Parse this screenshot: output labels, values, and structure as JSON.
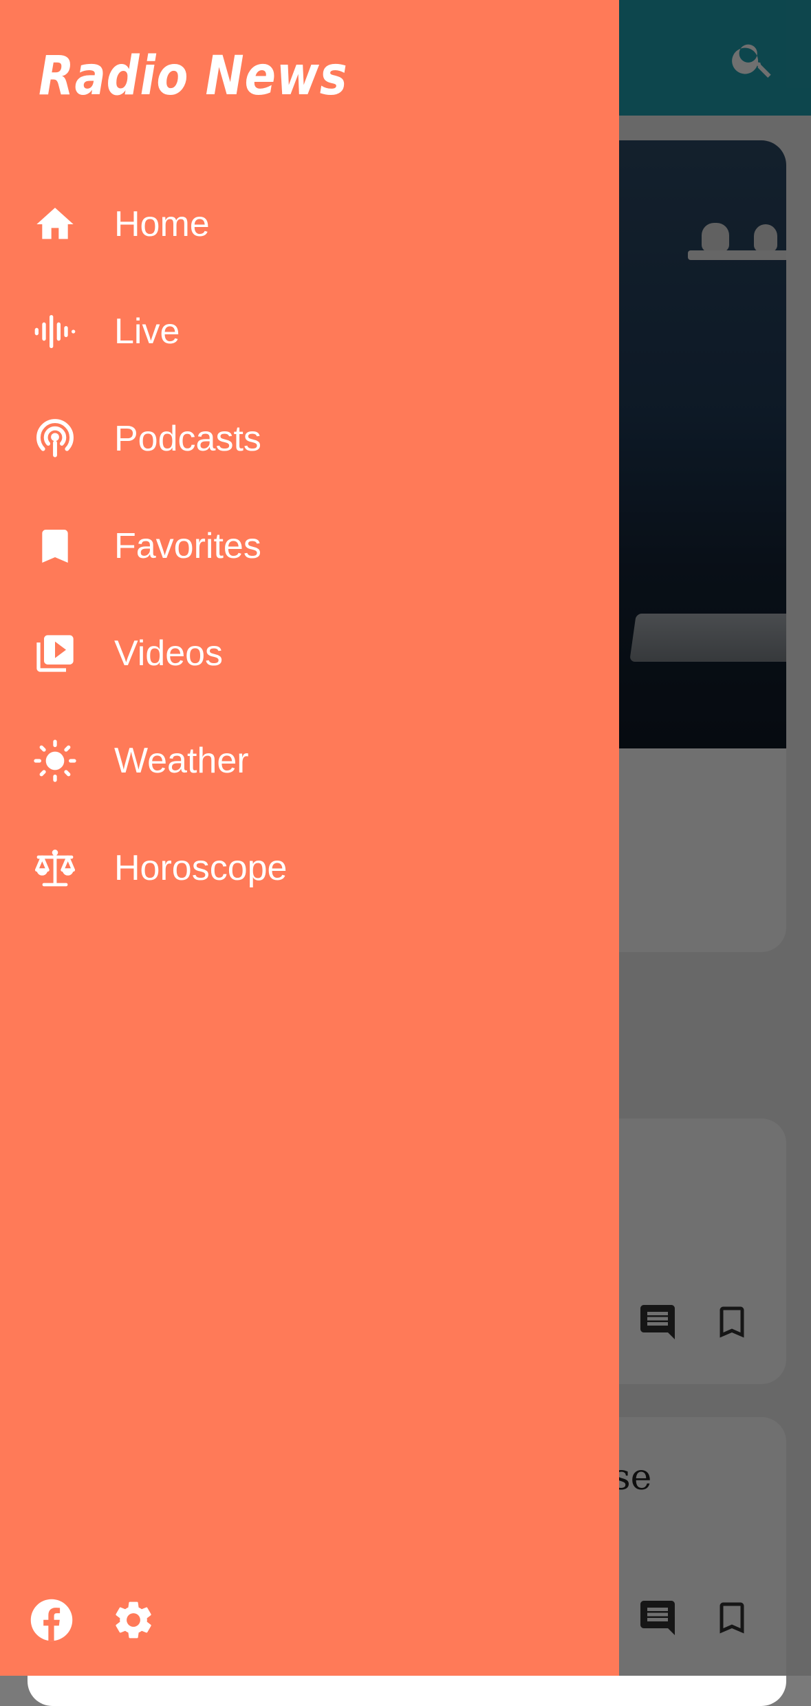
{
  "drawer": {
    "title": "Radio News",
    "items": [
      {
        "label": "Home",
        "icon": "home-icon"
      },
      {
        "label": "Live",
        "icon": "live-audio-icon"
      },
      {
        "label": "Podcasts",
        "icon": "podcast-icon"
      },
      {
        "label": "Favorites",
        "icon": "bookmark-icon"
      },
      {
        "label": "Videos",
        "icon": "video-library-icon"
      },
      {
        "label": "Weather",
        "icon": "sun-icon"
      },
      {
        "label": "Horoscope",
        "icon": "balance-scale-icon"
      }
    ],
    "footer_icons": [
      "facebook-icon",
      "gear-icon"
    ]
  },
  "background": {
    "card3_text_fragment": "se"
  },
  "colors": {
    "drawer_bg": "#ff7a58",
    "appbar": "#1f9fb0",
    "text_on_drawer": "#ffffff"
  }
}
